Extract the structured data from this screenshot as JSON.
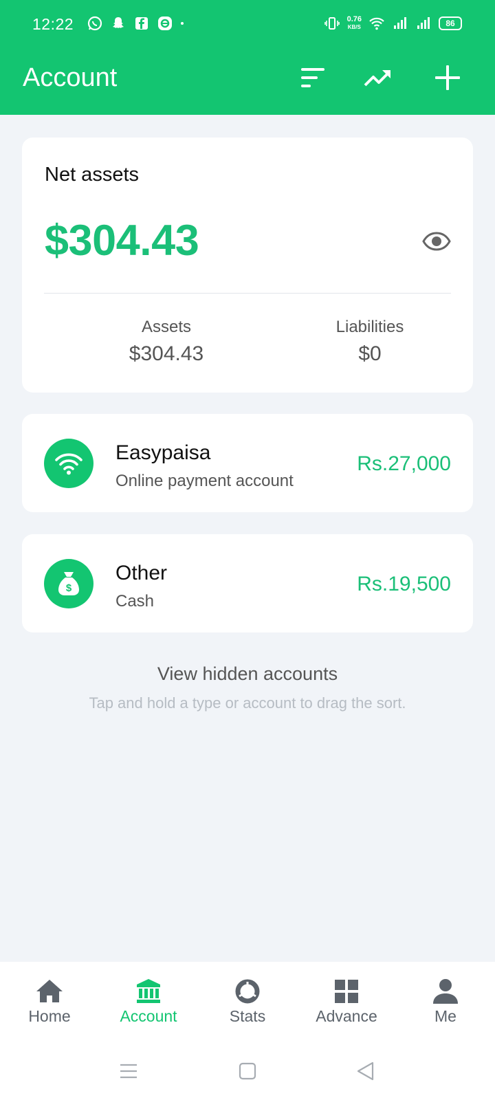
{
  "status_bar": {
    "time": "12:22",
    "net_speed_value": "0.76",
    "net_speed_unit": "KB/S",
    "battery": "86"
  },
  "header": {
    "title": "Account",
    "actions": [
      {
        "icon": "sort-icon"
      },
      {
        "icon": "trend-icon"
      },
      {
        "icon": "add-icon"
      }
    ]
  },
  "net_assets": {
    "label": "Net assets",
    "amount": "$304.43",
    "assets_label": "Assets",
    "assets_value": "$304.43",
    "liabilities_label": "Liabilities",
    "liabilities_value": "$0"
  },
  "accounts": [
    {
      "name": "Easypaisa",
      "type": "Online payment account",
      "balance": "Rs.27,000",
      "icon": "wifi-icon"
    },
    {
      "name": "Other",
      "type": "Cash",
      "balance": "Rs.19,500",
      "icon": "money-bag-icon"
    }
  ],
  "view_hidden": "View hidden accounts",
  "hint": "Tap and hold a type or account to drag the sort.",
  "bottom_nav": [
    {
      "label": "Home",
      "icon": "home-icon"
    },
    {
      "label": "Account",
      "icon": "bank-icon",
      "active": true
    },
    {
      "label": "Stats",
      "icon": "stats-icon"
    },
    {
      "label": "Advance",
      "icon": "grid-icon"
    },
    {
      "label": "Me",
      "icon": "person-icon"
    }
  ],
  "colors": {
    "primary": "#13c571",
    "amount_green": "#1bbf78",
    "background": "#f1f4f8"
  }
}
